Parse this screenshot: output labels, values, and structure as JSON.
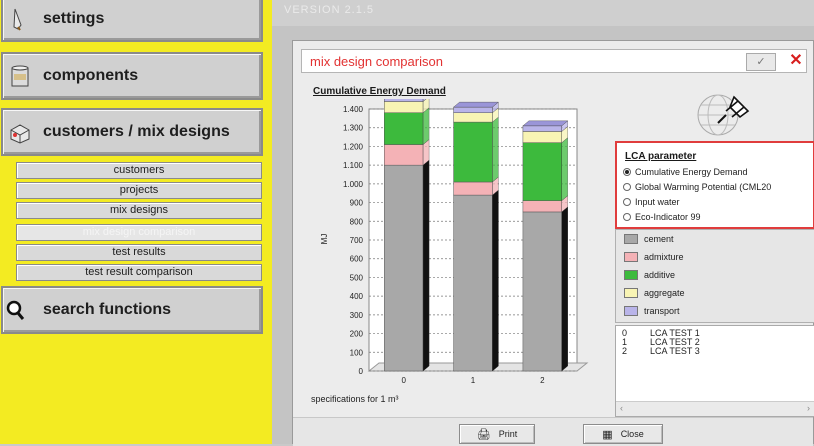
{
  "sidebar": {
    "main_items": [
      {
        "label": "settings",
        "icon": "brush-icon"
      },
      {
        "label": "components",
        "icon": "bucket-icon"
      },
      {
        "label": "customers / mix designs",
        "icon": "box-icon"
      },
      {
        "label": "search functions",
        "icon": "magnifier-icon"
      }
    ],
    "sub_items": [
      {
        "label": "customers",
        "enabled": true
      },
      {
        "label": "projects",
        "enabled": true
      },
      {
        "label": "mix designs",
        "enabled": true
      },
      {
        "label": "mix design comparison",
        "enabled": false
      },
      {
        "label": "test results",
        "enabled": true
      },
      {
        "label": "test result comparison",
        "enabled": true
      }
    ]
  },
  "topbar": {
    "title": "VERSION 2.1.5"
  },
  "dialog": {
    "title": "mix design comparison",
    "chart_title": "Cumulative Energy Demand",
    "spec_label": "specifications for 1 m³",
    "lca": {
      "title": "LCA parameter",
      "options": [
        {
          "label": "Cumulative Energy Demand",
          "selected": true
        },
        {
          "label": "Global Warming Potential (CML20",
          "selected": false
        },
        {
          "label": "Input water",
          "selected": false
        },
        {
          "label": "Eco-Indicator 99",
          "selected": false
        }
      ]
    },
    "legend": [
      {
        "label": "cement",
        "color": "#a8a8a8"
      },
      {
        "label": "admixture",
        "color": "#f4b2b6"
      },
      {
        "label": "additive",
        "color": "#3dba3d"
      },
      {
        "label": "aggregate",
        "color": "#f8f4b4"
      },
      {
        "label": "transport",
        "color": "#b9b4e9"
      }
    ],
    "list": [
      {
        "idx": "0",
        "name": "LCA TEST 1"
      },
      {
        "idx": "1",
        "name": "LCA TEST 2"
      },
      {
        "idx": "2",
        "name": "LCA TEST 3"
      }
    ],
    "buttons": {
      "print": "Print",
      "close": "Close"
    }
  },
  "chart_data": {
    "type": "bar",
    "stacked": true,
    "title": "Cumulative Energy Demand",
    "xlabel": "",
    "ylabel": "MJ",
    "ylim": [
      0,
      1400
    ],
    "yticks": [
      "0",
      "100",
      "200",
      "300",
      "400",
      "500",
      "600",
      "700",
      "800",
      "900",
      "1.000",
      "1.100",
      "1.200",
      "1.300",
      "1.400"
    ],
    "categories": [
      "0",
      "1",
      "2"
    ],
    "series": [
      {
        "name": "cement",
        "values": [
          1100,
          940,
          850
        ]
      },
      {
        "name": "admixture",
        "values": [
          110,
          70,
          60
        ]
      },
      {
        "name": "additive",
        "values": [
          170,
          320,
          310
        ]
      },
      {
        "name": "aggregate",
        "values": [
          60,
          50,
          60
        ]
      },
      {
        "name": "transport",
        "values": [
          30,
          30,
          30
        ]
      }
    ],
    "grid": true
  }
}
